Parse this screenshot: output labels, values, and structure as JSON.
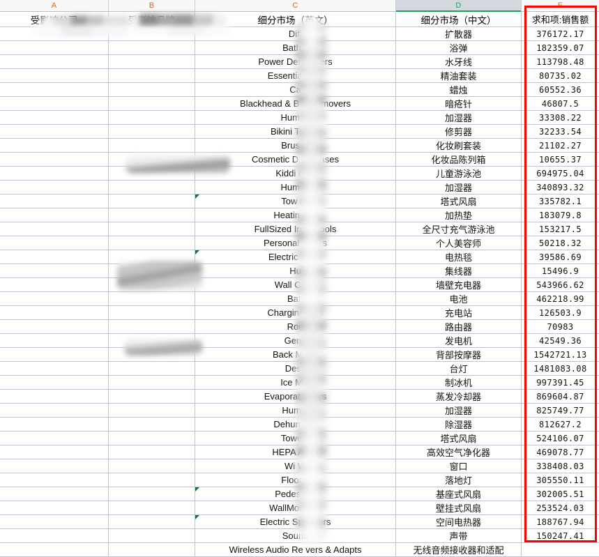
{
  "app": {
    "type": "spreadsheet",
    "accent_selected_column": "#17a25c",
    "highlight_box_color": "#ff0000",
    "gridline_color": "#bcc3d2"
  },
  "column_headers": [
    {
      "letter": "A",
      "selected": false
    },
    {
      "letter": "B",
      "selected": false
    },
    {
      "letter": "C",
      "selected": false
    },
    {
      "letter": "D",
      "selected": true
    },
    {
      "letter": "E",
      "selected": false
    }
  ],
  "table": {
    "headers": {
      "a": "受影响公司",
      "b": "受影响品牌",
      "c": "细分市场（英文）",
      "d": "细分市场（中文）",
      "e": "求和项:销售额"
    },
    "rows": [
      {
        "a": "",
        "b": "",
        "c": "Diff",
        "c_redacted": true,
        "d": "扩散器",
        "e": "376172.17",
        "err": false
      },
      {
        "a": "",
        "b": "",
        "c": "Bath            s",
        "c_redacted": true,
        "d": "浴弹",
        "e": "182359.07",
        "err": false
      },
      {
        "a": "",
        "b": "",
        "c": "Power Den        ossers",
        "c_redacted": true,
        "d": "水牙线",
        "e": "113798.48",
        "err": false
      },
      {
        "a": "",
        "b": "",
        "c": "Essentia      Sets",
        "c_redacted": true,
        "d": "精油套装",
        "e": "80735.02",
        "err": false
      },
      {
        "a": "",
        "b": "",
        "c": "Ca",
        "c_redacted": true,
        "d": "蜡烛",
        "e": "60552.36",
        "err": false
      },
      {
        "a": "",
        "b": "",
        "c": "Blackhead & B      h Removers",
        "c_redacted": true,
        "d": "暗疮针",
        "e": "46807.5",
        "err": false
      },
      {
        "a": "",
        "b": "",
        "c": "Hum        rs",
        "c_redacted": true,
        "d": "加湿器",
        "e": "33308.22",
        "err": false
      },
      {
        "a": "",
        "b": "",
        "c": "Bikini T       ners",
        "c_redacted": true,
        "d": "修剪器",
        "e": "32233.54",
        "err": false
      },
      {
        "a": "",
        "b": "",
        "c": "Brus        ts",
        "c_redacted": true,
        "d": "化妆刷套装",
        "e": "21102.27",
        "err": false
      },
      {
        "a": "",
        "b": "",
        "c": "Cosmetic D      ay Cases",
        "c_redacted": true,
        "d": "化妆品陈列箱",
        "e": "10655.37",
        "err": false
      },
      {
        "a": "",
        "b": "",
        "c": "Kiddi       ools",
        "c_redacted": true,
        "d": "儿童游泳池",
        "e": "694975.04",
        "err": false
      },
      {
        "a": "",
        "b": "",
        "c": "Hum         rs",
        "c_redacted": true,
        "d": "加湿器",
        "e": "340893.32",
        "err": false
      },
      {
        "a": "",
        "b": "",
        "c": "Tow        ns",
        "c_redacted": true,
        "d": "塔式风扇",
        "e": "335782.1",
        "err": true
      },
      {
        "a": "",
        "b": "",
        "c": "Heatin       ads",
        "c_redacted": true,
        "d": "加热垫",
        "e": "183079.8",
        "err": false
      },
      {
        "a": "",
        "b": "",
        "c": "FullSized In      le Pools",
        "c_redacted": true,
        "d": "全尺寸充气游泳池",
        "e": "153217.5",
        "err": false
      },
      {
        "a": "",
        "b": "",
        "c": "Personal       omers",
        "c_redacted": true,
        "d": "个人美容师",
        "e": "50218.32",
        "err": false
      },
      {
        "a": "",
        "b": "",
        "c": "Electric       nkets",
        "c_redacted": true,
        "d": "电热毯",
        "e": "39586.69",
        "err": true
      },
      {
        "a": "",
        "b": "",
        "c": "Hu",
        "c_redacted": true,
        "d": "集线器",
        "e": "15496.9",
        "err": false
      },
      {
        "a": "",
        "b": "",
        "c": "Wall C        ers",
        "c_redacted": true,
        "d": "墙壁充电器",
        "e": "543966.62",
        "err": false
      },
      {
        "a": "",
        "b": "",
        "c": "Batt",
        "c_redacted": true,
        "d": "电池",
        "e": "462218.99",
        "err": false
      },
      {
        "a": "",
        "b": "",
        "c": "Charging       ions",
        "c_redacted": true,
        "d": "充电站",
        "e": "126503.9",
        "err": false
      },
      {
        "a": "",
        "b": "",
        "c": "Rou",
        "c_redacted": true,
        "d": "路由器",
        "e": "70983",
        "err": false
      },
      {
        "a": "",
        "b": "",
        "c": "Gene",
        "c_redacted": true,
        "d": "发电机",
        "e": "42549.36",
        "err": false
      },
      {
        "a": "",
        "b": "",
        "c": "Back M        ers",
        "c_redacted": true,
        "d": "背部按摩器",
        "e": "1542721.13",
        "err": false
      },
      {
        "a": "",
        "b": "",
        "c": "Desk",
        "c_redacted": true,
        "d": "台灯",
        "e": "1481083.08",
        "err": false
      },
      {
        "a": "",
        "b": "",
        "c": "Ice M      e",
        "c_redacted": true,
        "d": "制冰机",
        "e": "997391.45",
        "err": false
      },
      {
        "a": "",
        "b": "",
        "c": "Evaporat     C      lers",
        "c_redacted": true,
        "d": "蒸发冷却器",
        "e": "869604.87",
        "err": false
      },
      {
        "a": "",
        "b": "",
        "c": "Hum        e",
        "c_redacted": true,
        "d": "加湿器",
        "e": "825749.77",
        "err": false
      },
      {
        "a": "",
        "b": "",
        "c": "Dehum       fi   s",
        "c_redacted": true,
        "d": "除湿器",
        "e": "812627.2",
        "err": false
      },
      {
        "a": "",
        "b": "",
        "c": "Towe       a",
        "c_redacted": true,
        "d": "塔式风扇",
        "e": "524106.07",
        "err": false
      },
      {
        "a": "",
        "b": "",
        "c": "HEPA A        ers",
        "c_redacted": true,
        "d": "高效空气净化器",
        "e": "469078.77",
        "err": false
      },
      {
        "a": "",
        "b": "",
        "c": "Wi      W",
        "c_redacted": true,
        "d": "窗口",
        "e": "338408.03",
        "err": false
      },
      {
        "a": "",
        "b": "",
        "c": "Floor       n",
        "c_redacted": true,
        "d": "落地灯",
        "e": "305550.11",
        "err": false
      },
      {
        "a": "",
        "b": "",
        "c": "Pedes      F     s",
        "c_redacted": true,
        "d": "基座式风扇",
        "e": "302005.51",
        "err": true
      },
      {
        "a": "",
        "b": "",
        "c": "WallMou         ans",
        "c_redacted": true,
        "d": "壁挂式风扇",
        "e": "253524.03",
        "err": false
      },
      {
        "a": "",
        "b": "",
        "c": "Electric Sp       eaters",
        "c_redacted": true,
        "d": "空间电热器",
        "e": "188767.94",
        "err": true
      },
      {
        "a": "",
        "b": "",
        "c": "Sound",
        "c_redacted": true,
        "d": "声带",
        "e": "150247.41",
        "err": false
      },
      {
        "a": "",
        "b": "",
        "c": "Wireless Audio Re      vers & Adapts",
        "c_redacted": true,
        "d": "无线音频接收器和适配",
        "e": "",
        "err": false
      }
    ]
  }
}
